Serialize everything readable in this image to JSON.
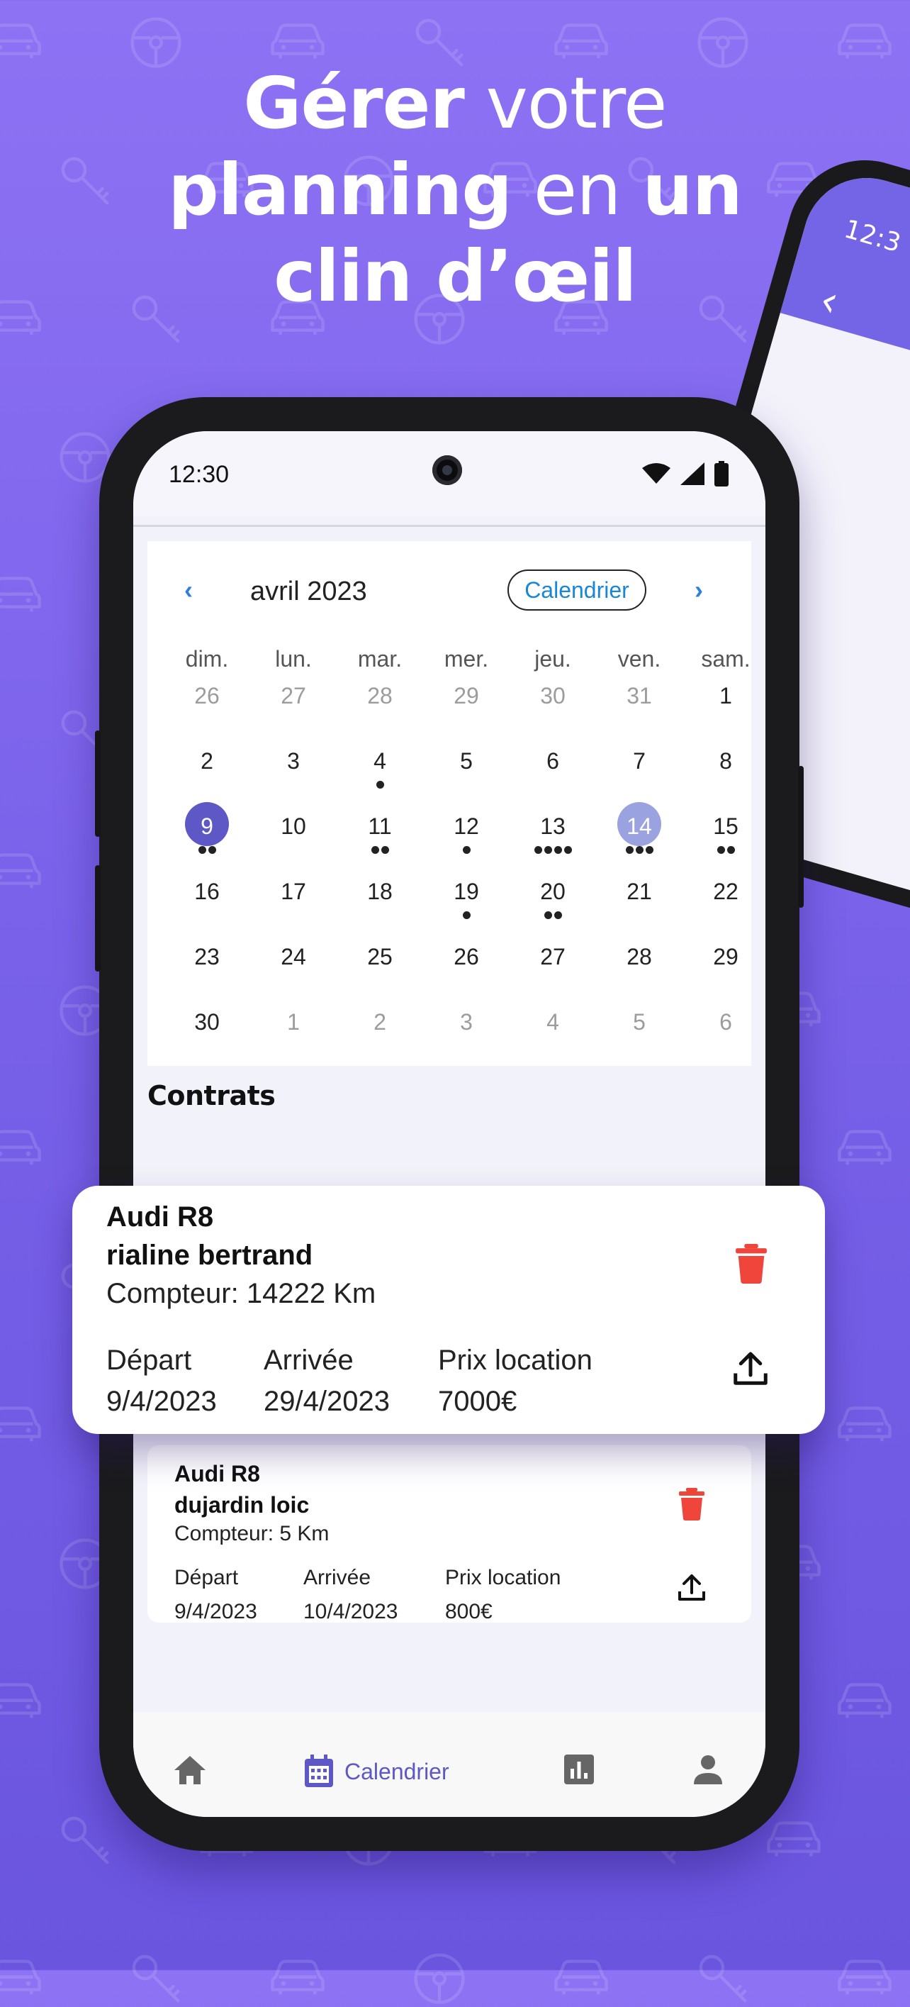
{
  "headline": {
    "line1_bold": "Gérer",
    "line1_light": "votre",
    "line2_bold": "planning",
    "line2_light": "en",
    "line2_bold2": "un",
    "line3_bold": "clin d’œil"
  },
  "second_phone": {
    "time_fragment": "12:3",
    "back_glyph": "‹"
  },
  "status_bar": {
    "time": "12:30",
    "icons": [
      "wifi-icon",
      "signal-icon",
      "battery-icon"
    ]
  },
  "calendar": {
    "month": "avril 2023",
    "mode_button": "Calendrier",
    "prev_glyph": "‹",
    "next_glyph": "›",
    "weekdays": [
      "dim.",
      "lun.",
      "mar.",
      "mer.",
      "jeu.",
      "ven.",
      "sam."
    ],
    "weeks": [
      [
        {
          "d": "26",
          "o": 1,
          "n": 0
        },
        {
          "d": "27",
          "o": 1,
          "n": 0
        },
        {
          "d": "28",
          "o": 1,
          "n": 0
        },
        {
          "d": "29",
          "o": 1,
          "n": 0
        },
        {
          "d": "30",
          "o": 1,
          "n": 0
        },
        {
          "d": "31",
          "o": 1,
          "n": 0
        },
        {
          "d": "1",
          "o": 0,
          "n": 0
        }
      ],
      [
        {
          "d": "2",
          "o": 0,
          "n": 0
        },
        {
          "d": "3",
          "o": 0,
          "n": 0
        },
        {
          "d": "4",
          "o": 0,
          "n": 1
        },
        {
          "d": "5",
          "o": 0,
          "n": 0
        },
        {
          "d": "6",
          "o": 0,
          "n": 0
        },
        {
          "d": "7",
          "o": 0,
          "n": 0
        },
        {
          "d": "8",
          "o": 0,
          "n": 0
        }
      ],
      [
        {
          "d": "9",
          "o": 0,
          "n": 2,
          "sel": 1
        },
        {
          "d": "10",
          "o": 0,
          "n": 0
        },
        {
          "d": "11",
          "o": 0,
          "n": 2
        },
        {
          "d": "12",
          "o": 0,
          "n": 1
        },
        {
          "d": "13",
          "o": 0,
          "n": 4
        },
        {
          "d": "14",
          "o": 0,
          "n": 3,
          "today": 1
        },
        {
          "d": "15",
          "o": 0,
          "n": 2
        }
      ],
      [
        {
          "d": "16",
          "o": 0,
          "n": 0
        },
        {
          "d": "17",
          "o": 0,
          "n": 0
        },
        {
          "d": "18",
          "o": 0,
          "n": 0
        },
        {
          "d": "19",
          "o": 0,
          "n": 1
        },
        {
          "d": "20",
          "o": 0,
          "n": 2
        },
        {
          "d": "21",
          "o": 0,
          "n": 0
        },
        {
          "d": "22",
          "o": 0,
          "n": 0
        }
      ],
      [
        {
          "d": "23",
          "o": 0,
          "n": 0
        },
        {
          "d": "24",
          "o": 0,
          "n": 0
        },
        {
          "d": "25",
          "o": 0,
          "n": 0
        },
        {
          "d": "26",
          "o": 0,
          "n": 0
        },
        {
          "d": "27",
          "o": 0,
          "n": 0
        },
        {
          "d": "28",
          "o": 0,
          "n": 0
        },
        {
          "d": "29",
          "o": 0,
          "n": 0
        }
      ],
      [
        {
          "d": "30",
          "o": 0,
          "n": 0
        },
        {
          "d": "1",
          "o": 1,
          "n": 0
        },
        {
          "d": "2",
          "o": 1,
          "n": 0
        },
        {
          "d": "3",
          "o": 1,
          "n": 0
        },
        {
          "d": "4",
          "o": 1,
          "n": 0
        },
        {
          "d": "5",
          "o": 1,
          "n": 0
        },
        {
          "d": "6",
          "o": 1,
          "n": 0
        }
      ]
    ]
  },
  "section_title": "Contrats",
  "contracts": [
    {
      "car": "Audi R8",
      "client": "rialine bertrand",
      "counter": "Compteur: 14222 Km",
      "departure_label": "Départ",
      "arrival_label": "Arrivée",
      "price_label": "Prix location",
      "departure": "9/4/2023",
      "arrival": "29/4/2023",
      "price": "7000€"
    },
    {
      "car": "Audi R8",
      "client": "dujardin loic",
      "counter": "Compteur: 5 Km",
      "departure_label": "Départ",
      "arrival_label": "Arrivée",
      "price_label": "Prix location",
      "departure": "9/4/2023",
      "arrival": "10/4/2023",
      "price": "800€"
    }
  ],
  "bottom_nav": {
    "items": [
      {
        "icon": "home-icon"
      },
      {
        "icon": "calendar-icon",
        "label": "Calendrier",
        "active": true
      },
      {
        "icon": "stats-icon"
      },
      {
        "icon": "profile-icon"
      }
    ]
  },
  "colors": {
    "background": "#7d65ec",
    "accent": "#5d58c6",
    "link_blue": "#1a86d8",
    "delete_red": "#f0453a",
    "today_circle": "#9aa3e0"
  }
}
